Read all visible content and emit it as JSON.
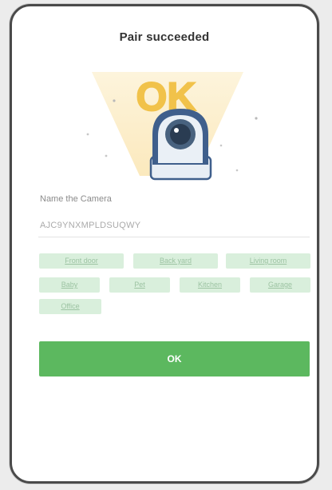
{
  "dialog": {
    "title": "Pair succeeded",
    "badge_text": "OK"
  },
  "name_field": {
    "label": "Name the Camera",
    "value": "AJC9YNXMPLDSUQWY"
  },
  "preset_names": [
    "Front door",
    "Back yard",
    "Living room",
    "Baby",
    "Pet",
    "Kitchen",
    "Garage",
    "Office"
  ],
  "confirm_button": {
    "label": "OK"
  },
  "colors": {
    "accent_green": "#5cb85f",
    "chip_bg": "#d9efdc",
    "ok_badge_yellow": "#f1c24a",
    "camera_blue": "#3f5f8c"
  }
}
